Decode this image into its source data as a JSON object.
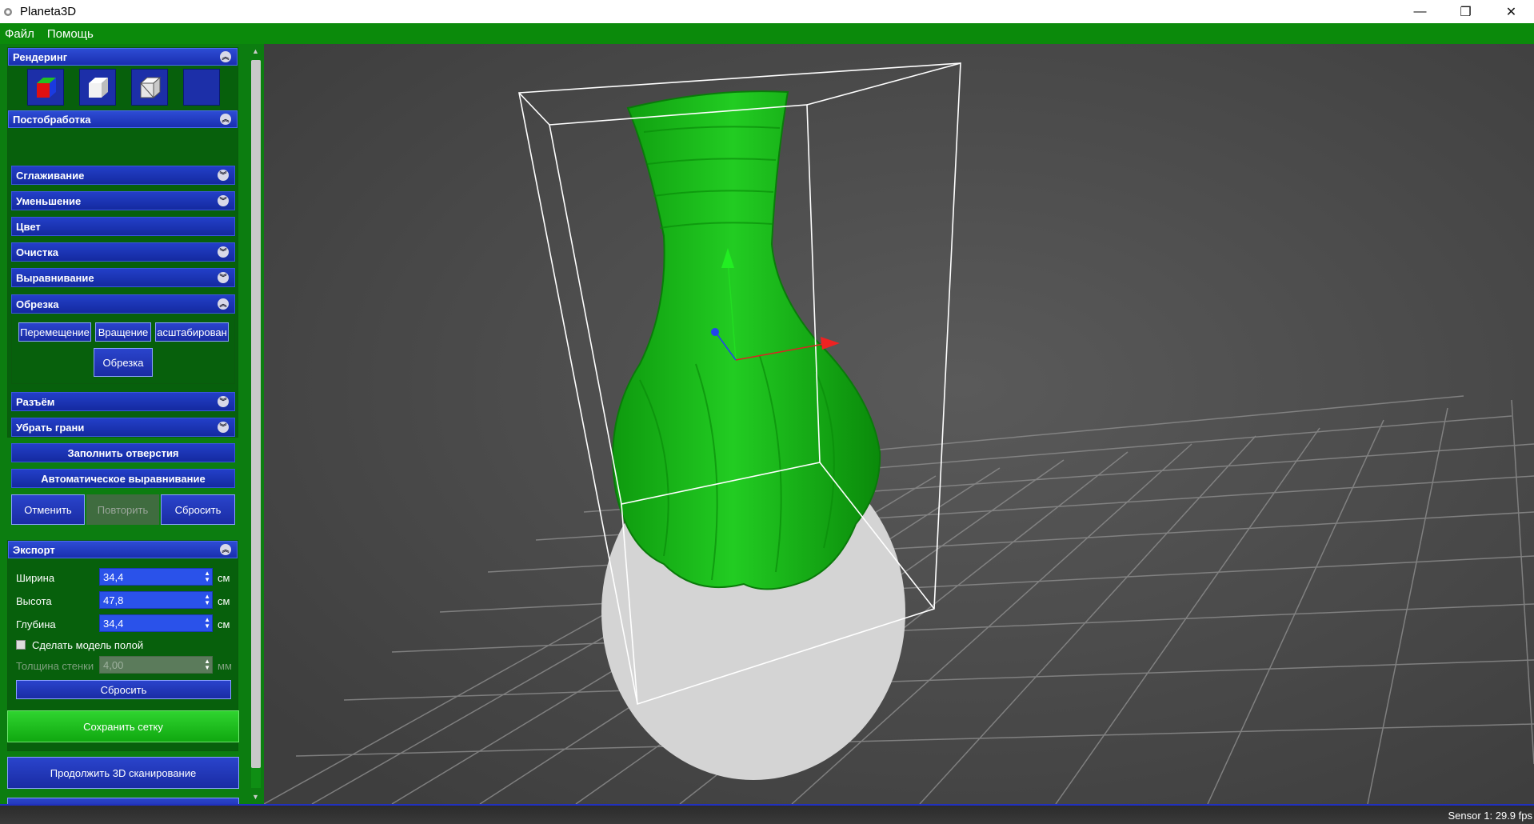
{
  "window": {
    "title": "Planeta3D",
    "minimize": "—",
    "maximize": "❐",
    "close": "✕"
  },
  "menu": {
    "file": "Файл",
    "help": "Помощь"
  },
  "rendering": {
    "title": "Рендеринг",
    "chevron": "︽"
  },
  "postprocessing": {
    "title": "Постобработка",
    "items": {
      "smoothing": "Сглаживание",
      "reduction": "Уменьшение",
      "color": "Цвет",
      "cleaning": "Очистка",
      "alignment": "Выравнивание",
      "crop": "Обрезка",
      "connector": "Разъём",
      "remove_faces": "Убрать грани",
      "fill_holes": "Заполнить отверстия",
      "auto_align": "Автоматическое выравнивание"
    },
    "crop_tools": {
      "move": "Перемещение",
      "rotate": "Вращение",
      "scale": "асштабирован",
      "apply": "Обрезка"
    },
    "history": {
      "undo": "Отменить",
      "redo": "Повторить",
      "reset": "Сбросить"
    },
    "chev_down": "︾",
    "chev_up": "︽"
  },
  "export": {
    "title": "Экспорт",
    "width_label": "Ширина",
    "width_value": "34,4",
    "width_unit": "см",
    "height_label": "Высота",
    "height_value": "47,8",
    "height_unit": "см",
    "depth_label": "Глубина",
    "depth_value": "34,4",
    "depth_unit": "см",
    "hollow_label": "Сделать модель полой",
    "wall_label": "Толщина стенки",
    "wall_value": "4,00",
    "wall_unit": "мм",
    "reset": "Сбросить",
    "save_mesh": "Сохранить сетку",
    "continue_scan": "Продолжить 3D сканирование"
  },
  "statusbar": {
    "text": "Sensor 1: 29.9 fps"
  },
  "colors": {
    "menu_green": "#0b8a0b",
    "panel_blue": "#1a2fb0",
    "model_green": "#16c616"
  }
}
